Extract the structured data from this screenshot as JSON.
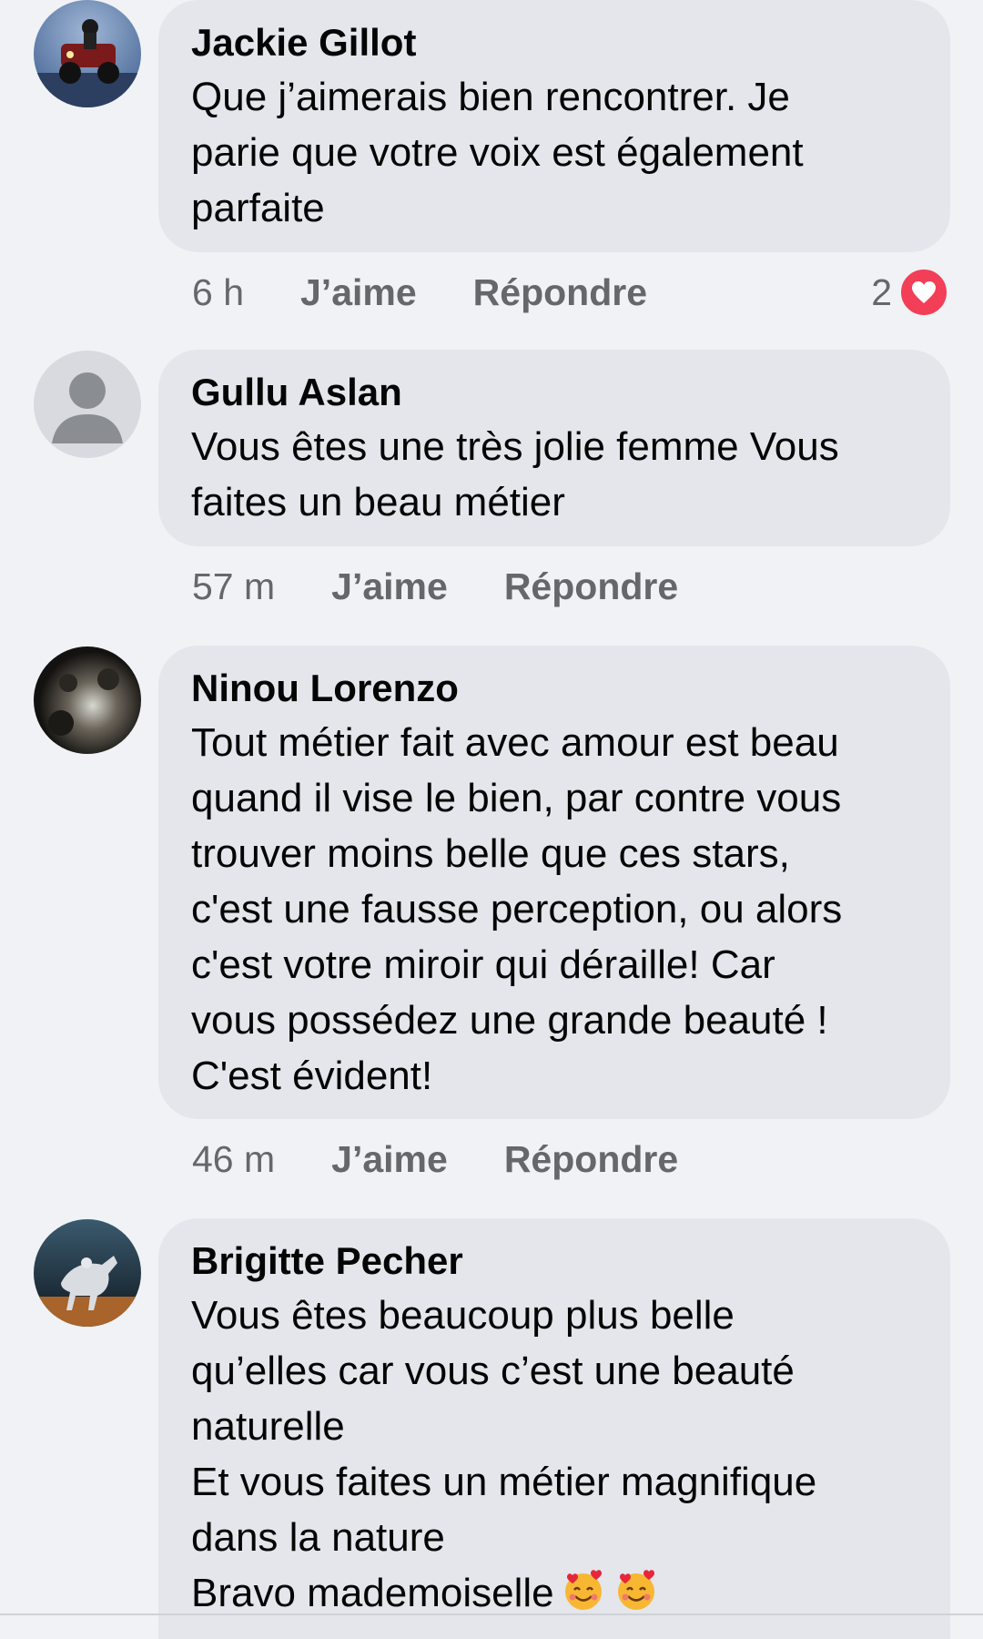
{
  "comments": [
    {
      "author": "Jackie Gillot",
      "text": "Que j’aimerais bien rencontrer. Je\nparie que votre voix est également\nparfaite",
      "time": "6 h",
      "like": "J’aime",
      "reply": "Répondre",
      "reaction_count": "2",
      "reaction_icon": "heart-icon",
      "avatar": "atv-photo-avatar"
    },
    {
      "author": "Gullu Aslan",
      "text": "Vous êtes une très jolie femme Vous\nfaites un beau métier",
      "time": "57 m",
      "like": "J’aime",
      "reply": "Répondre",
      "avatar": "default-user-avatar"
    },
    {
      "author": "Ninou Lorenzo",
      "text": "Tout métier fait avec amour est beau\nquand il vise le bien, par contre vous\ntrouver moins belle que ces stars,\nc'est une fausse perception, ou alors\nc'est votre miroir qui déraille! Car\nvous possédez une grande beauté !\nC'est évident!",
      "time": "46 m",
      "like": "J’aime",
      "reply": "Répondre",
      "avatar": "dark-photo-avatar"
    },
    {
      "author": "Brigitte Pecher",
      "text": "Vous êtes beaucoup plus belle\nqu’elles car vous c’est une beauté\nnaturelle\nEt vous faites un métier magnifique\ndans la nature\nBravo mademoiselle",
      "emoji": "smiling-face-with-hearts-emoji",
      "avatar": "horse-photo-avatar"
    }
  ],
  "colors": {
    "background": "#f0f2f5",
    "bubble": "#e4e6eb",
    "meta_text": "#65676b",
    "heart": "#f33e58"
  }
}
